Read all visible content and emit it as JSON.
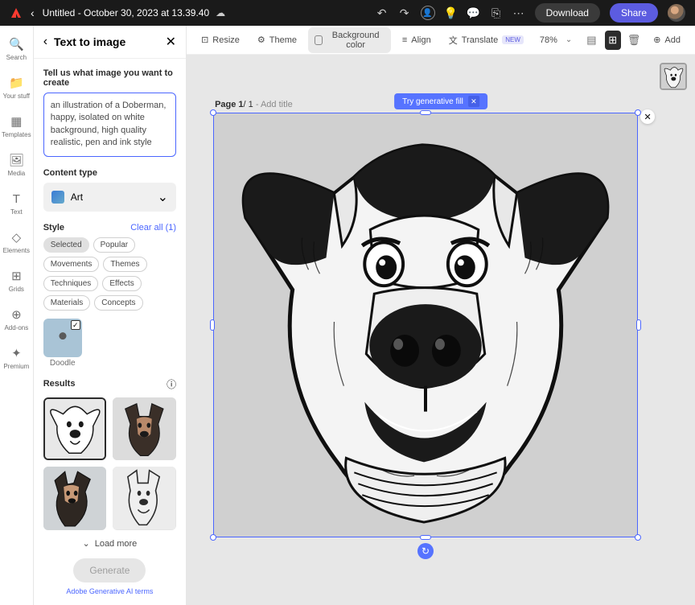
{
  "topbar": {
    "title": "Untitled - October 30, 2023 at 13.39.40",
    "download": "Download",
    "share": "Share"
  },
  "rail": {
    "search": "Search",
    "your_stuff": "Your stuff",
    "templates": "Templates",
    "media": "Media",
    "text": "Text",
    "elements": "Elements",
    "grids": "Grids",
    "addons": "Add-ons",
    "premium": "Premium"
  },
  "panel": {
    "title": "Text to image",
    "tell_us": "Tell us what image you want to create",
    "prompt": "an illustration of a Doberman, happy, isolated on white background, high quality realistic, pen and ink style",
    "content_type": "Content type",
    "content_type_value": "Art",
    "style_label": "Style",
    "clear_all": "Clear all (1)",
    "chips": [
      "Selected",
      "Popular",
      "Movements",
      "Themes",
      "Techniques",
      "Effects",
      "Materials",
      "Concepts"
    ],
    "selected_style": "Doodle",
    "results_label": "Results",
    "load_more": "Load more",
    "generate": "Generate",
    "ai_terms": "Adobe Generative AI terms"
  },
  "toolbar": {
    "resize": "Resize",
    "theme": "Theme",
    "bg": "Background color",
    "align": "Align",
    "translate": "Translate",
    "new_badge": "NEW",
    "zoom": "78%",
    "add": "Add"
  },
  "canvas": {
    "page_prefix": "Page 1",
    "page_total": "/ 1",
    "add_title": " - Add title",
    "tip": "Try generative fill"
  }
}
